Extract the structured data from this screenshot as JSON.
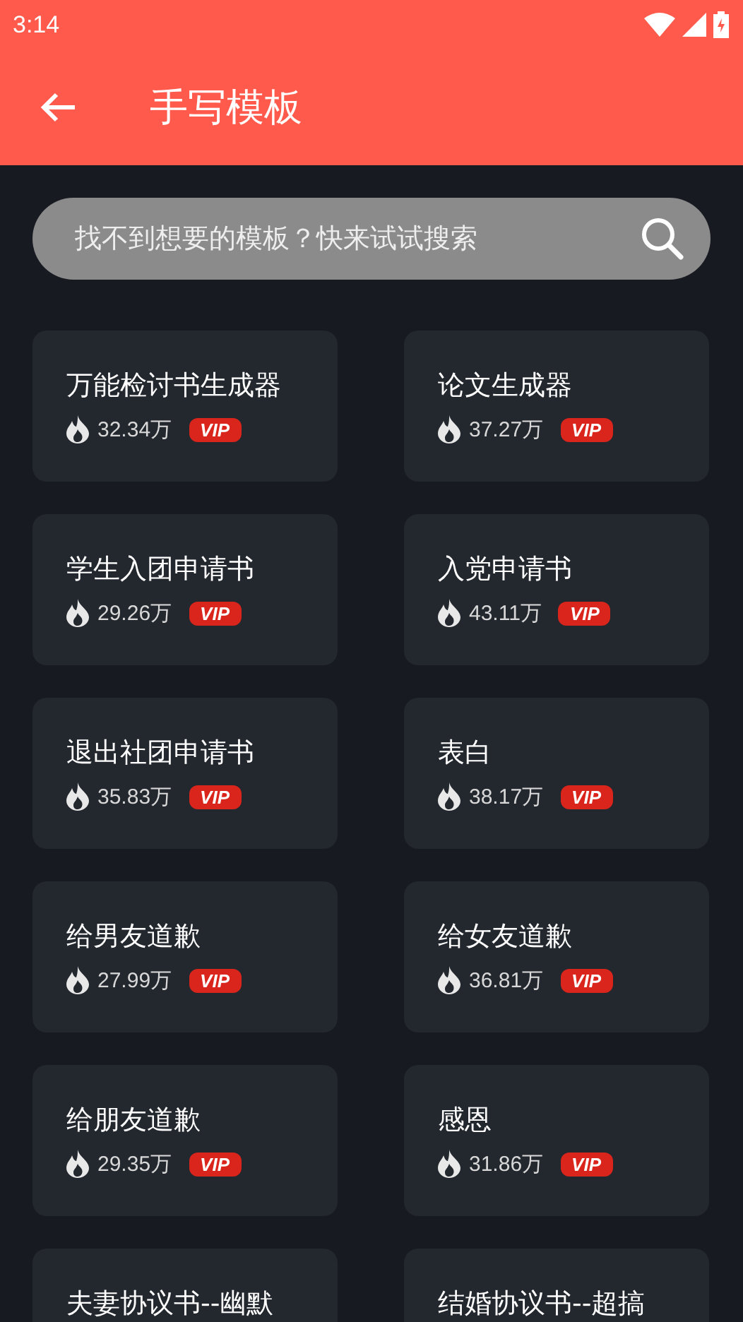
{
  "status_bar": {
    "time": "3:14"
  },
  "app_bar": {
    "title": "手写模板"
  },
  "search": {
    "placeholder": "找不到想要的模板？快来试试搜索"
  },
  "templates": [
    {
      "title": "万能检讨书生成器",
      "count": "32.34万",
      "badge": "VIP"
    },
    {
      "title": "论文生成器",
      "count": "37.27万",
      "badge": "VIP"
    },
    {
      "title": "学生入团申请书",
      "count": "29.26万",
      "badge": "VIP"
    },
    {
      "title": "入党申请书",
      "count": "43.11万",
      "badge": "VIP"
    },
    {
      "title": "退出社团申请书",
      "count": "35.83万",
      "badge": "VIP"
    },
    {
      "title": "表白",
      "count": "38.17万",
      "badge": "VIP"
    },
    {
      "title": "给男友道歉",
      "count": "27.99万",
      "badge": "VIP"
    },
    {
      "title": "给女友道歉",
      "count": "36.81万",
      "badge": "VIP"
    },
    {
      "title": "给朋友道歉",
      "count": "29.35万",
      "badge": "VIP"
    },
    {
      "title": "感恩",
      "count": "31.86万",
      "badge": "VIP"
    },
    {
      "title": "夫妻协议书--幽默"
    },
    {
      "title": "结婚协议书--超搞"
    }
  ]
}
